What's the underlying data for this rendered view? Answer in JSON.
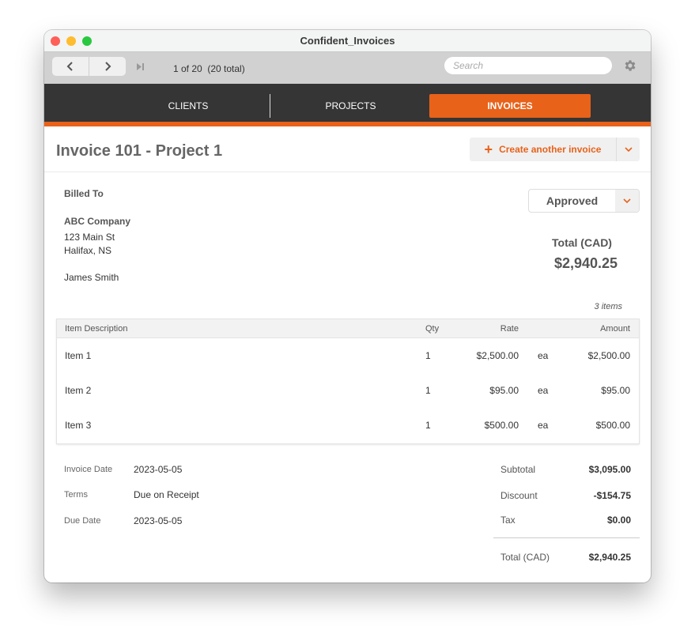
{
  "window": {
    "title": "Confident_Invoices"
  },
  "toolbar": {
    "prev_icon": "chevron-left-icon",
    "next_icon": "chevron-right-icon",
    "last_icon": "skip-to-end-icon",
    "record_count": "1 of 20  (20 total)",
    "search_placeholder": "Search",
    "search_value": "",
    "settings_icon": "gear-icon"
  },
  "nav": {
    "tabs": [
      {
        "label": "CLIENTS",
        "active": false
      },
      {
        "label": "PROJECTS",
        "active": false
      },
      {
        "label": "INVOICES",
        "active": true
      }
    ]
  },
  "colors": {
    "accent": "#e8621a",
    "navbar_bg": "#353535",
    "toolbar_bg": "#d1d1d1"
  },
  "header": {
    "title": "Invoice 101 - Project 1",
    "create_button": "Create another invoice"
  },
  "billing": {
    "label": "Billed To",
    "company": "ABC Company",
    "address_line1": "123 Main St",
    "address_line2": "Halifax, NS",
    "contact": "James Smith"
  },
  "status": {
    "value": "Approved"
  },
  "total_summary": {
    "label": "Total (CAD)",
    "value": "$2,940.25"
  },
  "items": {
    "count_label": "3 items",
    "columns": {
      "description": "Item Description",
      "qty": "Qty",
      "rate": "Rate",
      "amount": "Amount"
    },
    "rows": [
      {
        "description": "Item 1",
        "qty": "1",
        "rate": "$2,500.00",
        "unit": "ea",
        "amount": "$2,500.00"
      },
      {
        "description": "Item 2",
        "qty": "1",
        "rate": "$95.00",
        "unit": "ea",
        "amount": "$95.00"
      },
      {
        "description": "Item 3",
        "qty": "1",
        "rate": "$500.00",
        "unit": "ea",
        "amount": "$500.00"
      }
    ]
  },
  "details": {
    "invoice_date_label": "Invoice Date",
    "invoice_date": "2023-05-05",
    "terms_label": "Terms",
    "terms": "Due on Receipt",
    "due_date_label": "Due Date",
    "due_date": "2023-05-05"
  },
  "totals": {
    "subtotal_label": "Subtotal",
    "subtotal": "$3,095.00",
    "discount_label": "Discount",
    "discount": "-$154.75",
    "tax_label": "Tax",
    "tax": "$0.00",
    "total_label": "Total (CAD)",
    "total": "$2,940.25"
  }
}
